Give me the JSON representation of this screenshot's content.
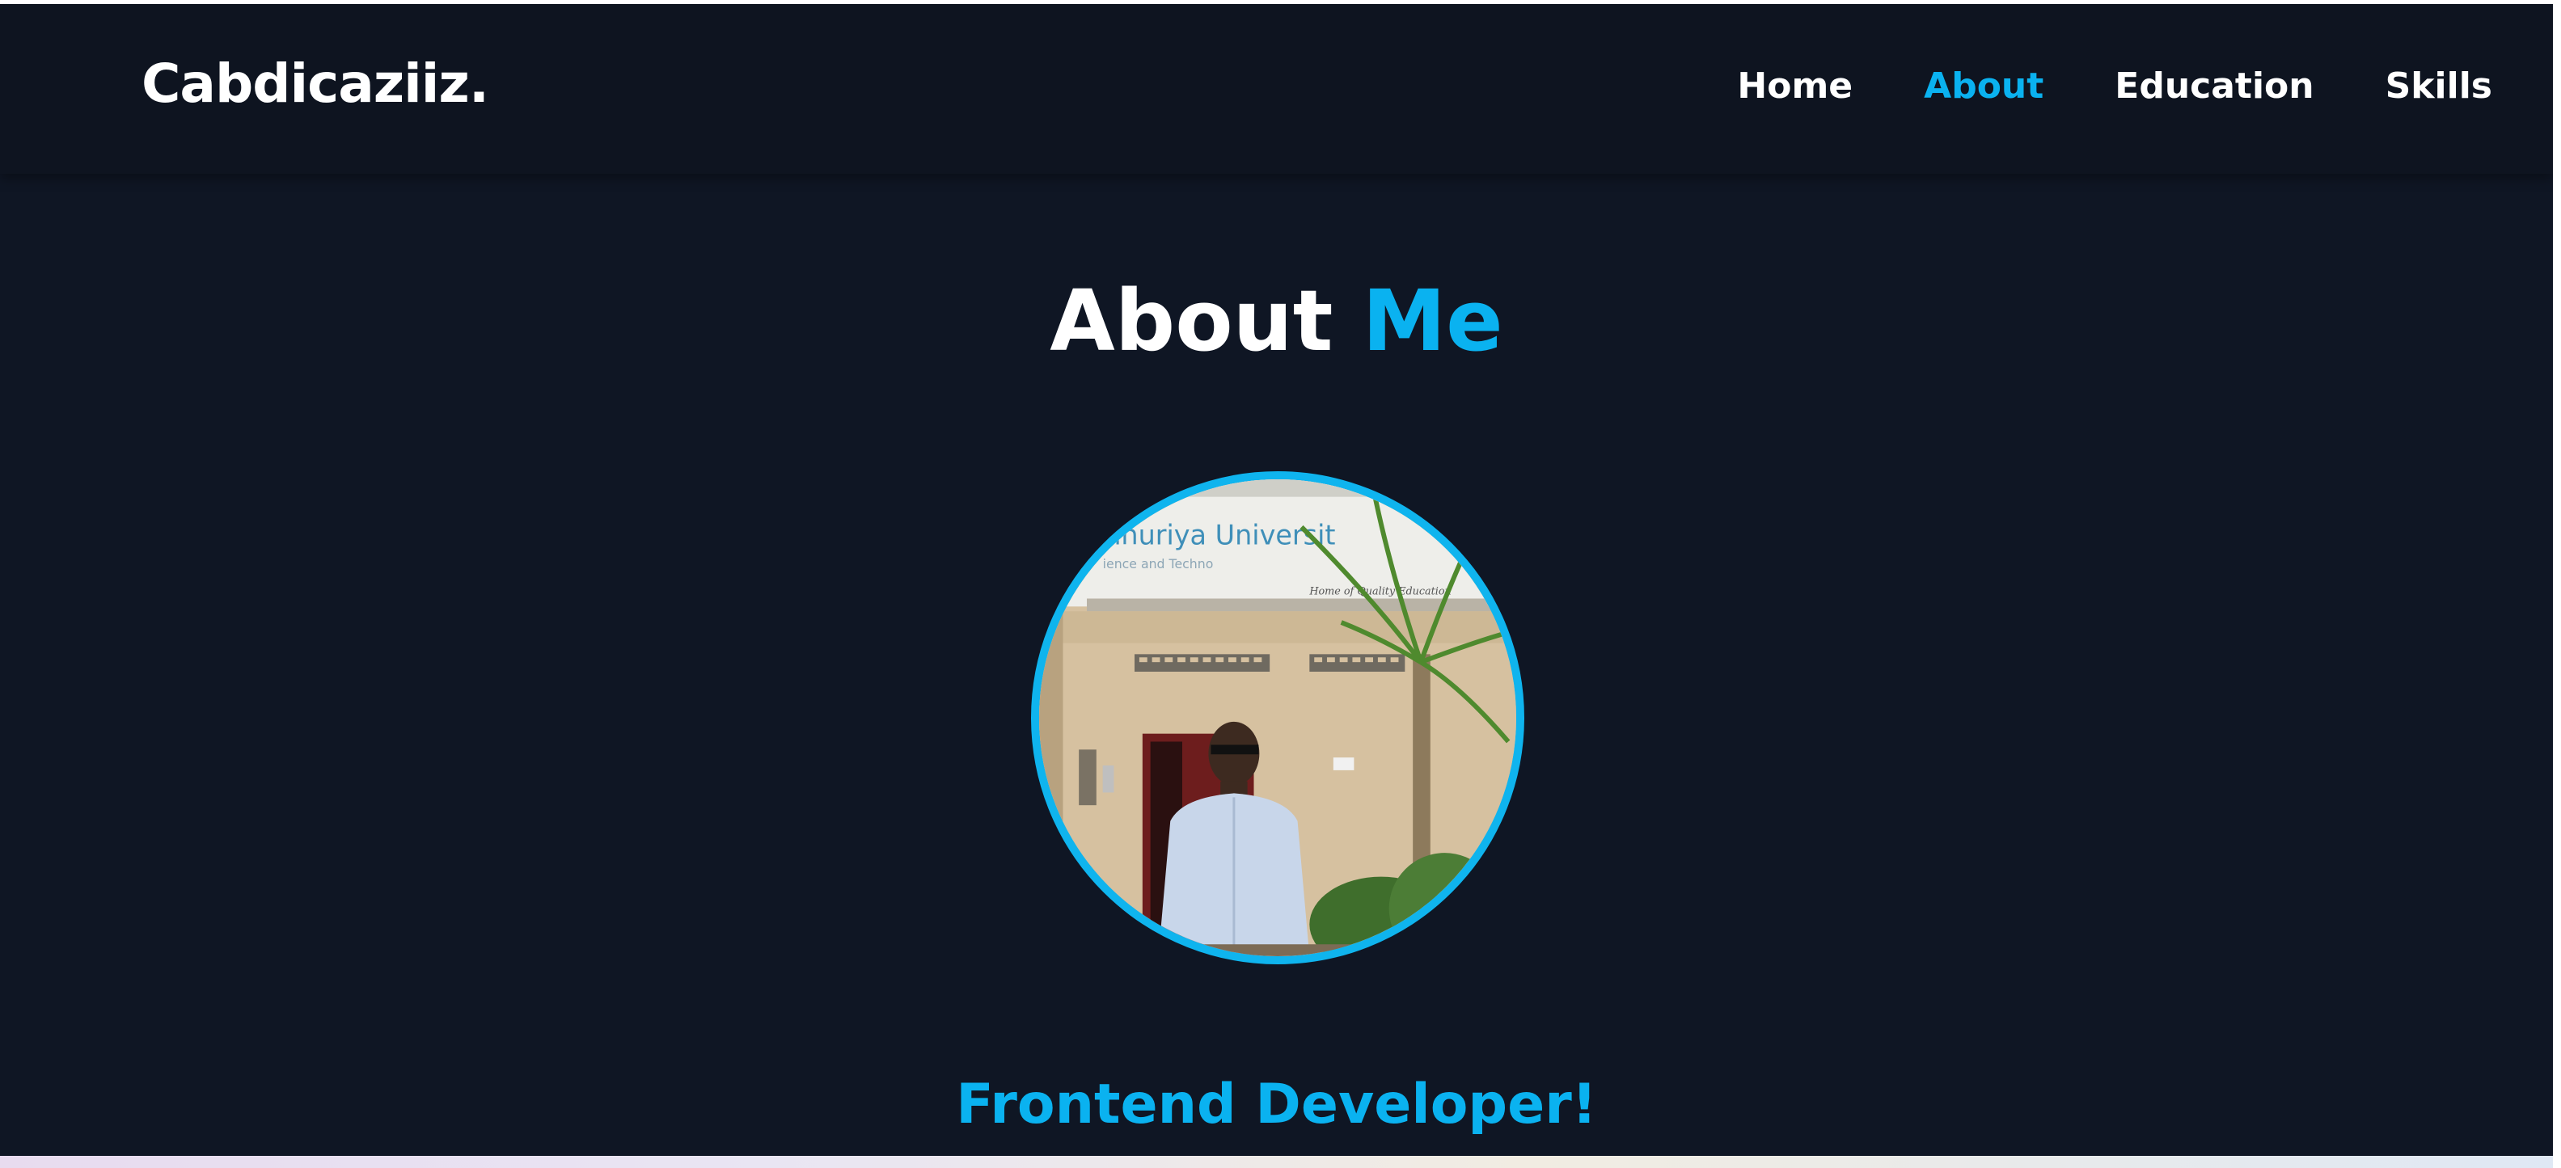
{
  "logo": {
    "text": "Cabdicaziiz."
  },
  "nav": {
    "items": [
      {
        "label": "Home",
        "active": false
      },
      {
        "label": "About",
        "active": true
      },
      {
        "label": "Education",
        "active": false
      },
      {
        "label": "Skills",
        "active": false
      }
    ]
  },
  "about": {
    "heading_main": "About",
    "heading_accent": "Me",
    "photo_alt": "Profile photo",
    "role": "Frontend Developer!"
  },
  "colors": {
    "background": "#0f1624",
    "navbar": "#0e1420",
    "accent": "#0ab2f0",
    "text": "#ffffff"
  }
}
